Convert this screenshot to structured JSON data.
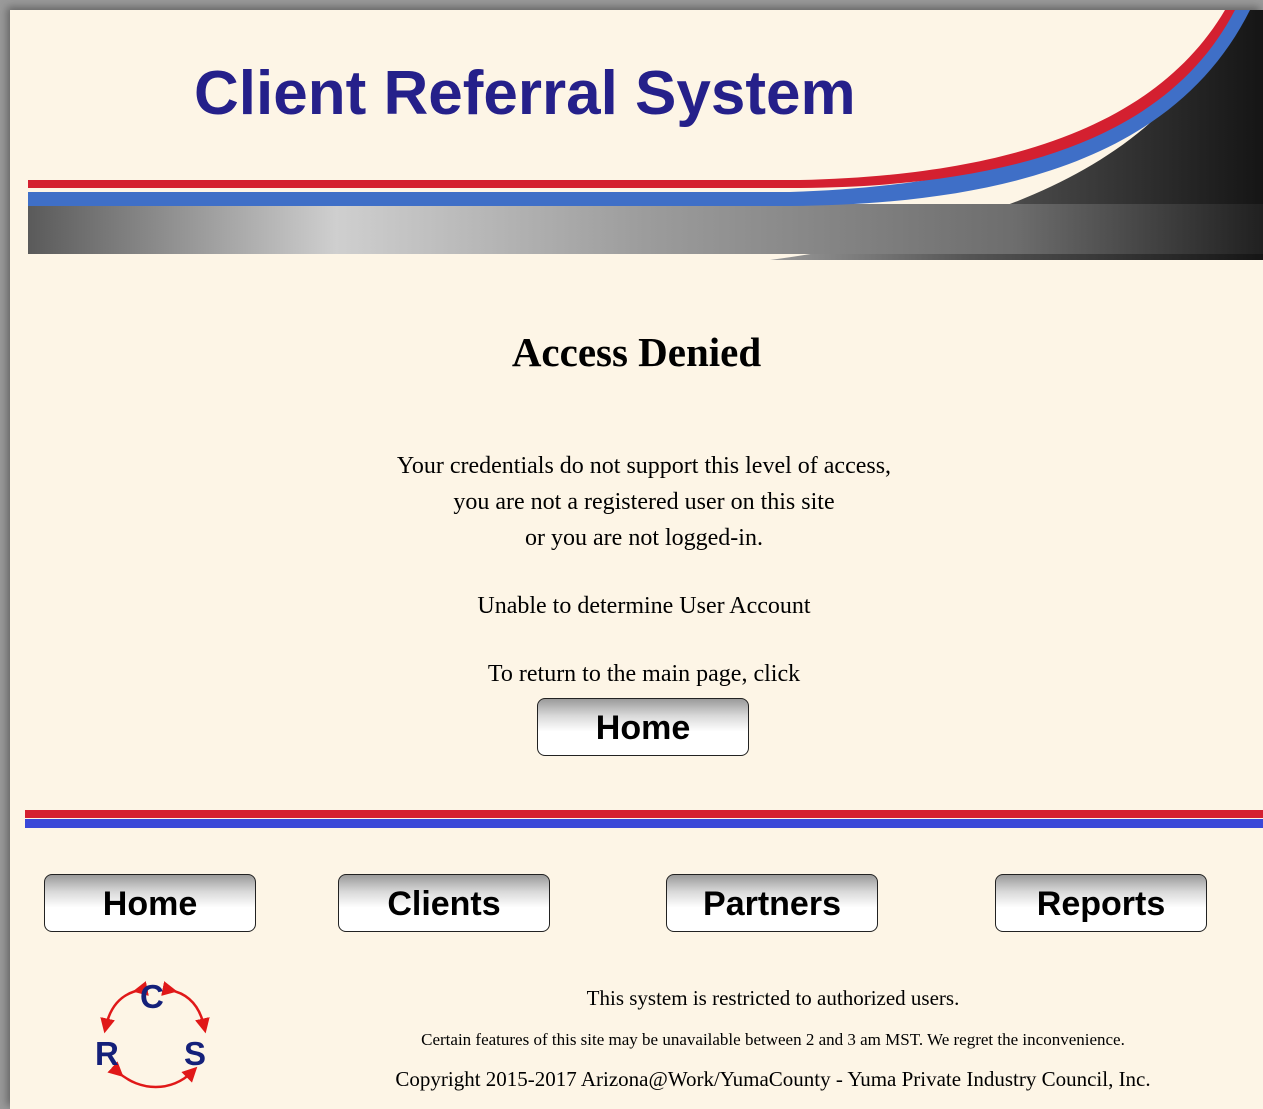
{
  "header": {
    "title": "Client Referral System"
  },
  "main": {
    "heading": "Access Denied",
    "message_lines": [
      "Your credentials do not support this level of access,",
      "you are not a registered user on this site",
      "or you are not logged-in."
    ],
    "account_status": "Unable to determine User Account",
    "return_prompt": "To return to the main page, click",
    "home_button": "Home"
  },
  "nav": {
    "items": [
      "Home",
      "Clients",
      "Partners",
      "Reports"
    ]
  },
  "footer": {
    "restricted": "This system is restricted to authorized users.",
    "maintenance": "Certain features of this site may be unavailable between 2 and 3 am MST. We regret the inconvenience.",
    "copyright": "Copyright 2015-2017 Arizona@Work/YumaCounty - Yuma Private Industry Council, Inc."
  },
  "logo": {
    "letters": [
      "C",
      "R",
      "S"
    ]
  },
  "colors": {
    "title": "#25208a",
    "page_background": "#fdf5e6",
    "stripe_red": "#d42030",
    "stripe_blue": "#3a48d8"
  }
}
